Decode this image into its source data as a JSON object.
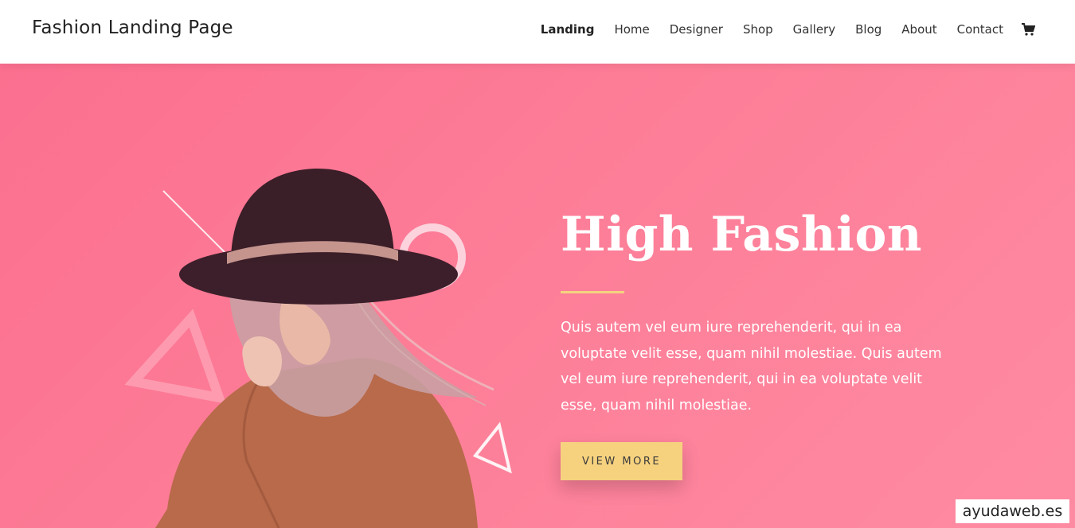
{
  "header": {
    "site_title": "Fashion Landing Page",
    "nav": [
      "Landing",
      "Home",
      "Designer",
      "Shop",
      "Gallery",
      "Blog",
      "About",
      "Contact"
    ],
    "active_item": "Landing",
    "cart_icon": "shopping-cart-icon"
  },
  "hero": {
    "title": "High Fashion",
    "description": "Quis autem vel eum iure reprehenderit, qui in ea voluptate velit esse, quam nihil molestiae. Quis autem vel eum iure reprehenderit, qui in ea voluptate velit esse, quam nihil molestiae.",
    "cta_label": "VIEW MORE",
    "accent_color": "#f6d27f",
    "background_color": "#fd7d97"
  },
  "watermark": "ayudaweb.es"
}
